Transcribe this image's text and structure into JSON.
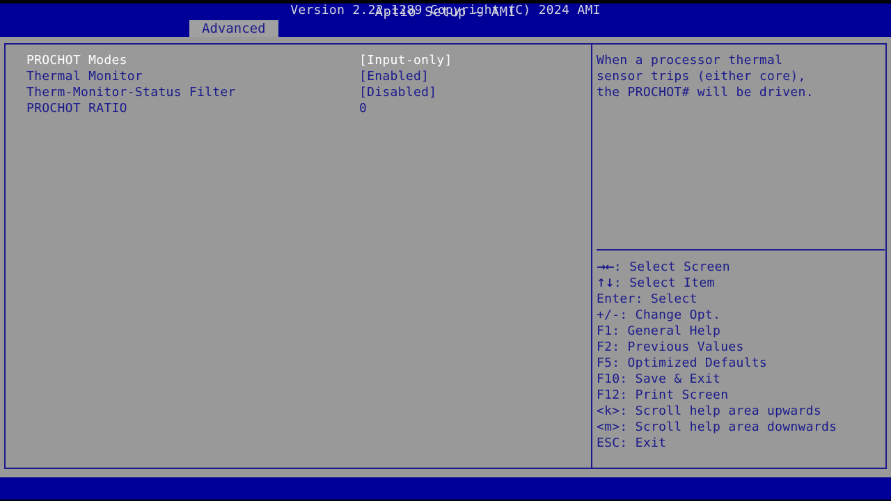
{
  "header": {
    "title": "Aptio Setup – AMI"
  },
  "tabs": [
    {
      "label": "Advanced",
      "active": true
    }
  ],
  "settings": [
    {
      "label": "PROCHOT Modes",
      "value": "[Input-only]",
      "selected": true
    },
    {
      "label": "Thermal Monitor",
      "value": "[Enabled]",
      "selected": false
    },
    {
      "label": "Therm-Monitor-Status Filter",
      "value": "[Disabled]",
      "selected": false
    },
    {
      "label": "PROCHOT RATIO",
      "value": "0",
      "selected": false
    }
  ],
  "help": {
    "text": "When a processor thermal\nsensor trips (either core),\nthe PROCHOT# will be driven."
  },
  "legend": [
    {
      "glyph": "→←",
      "text": ": Select Screen"
    },
    {
      "glyph": "↑↓",
      "text": ": Select Item"
    },
    {
      "glyph": "",
      "text": "Enter: Select"
    },
    {
      "glyph": "",
      "text": "+/-: Change Opt."
    },
    {
      "glyph": "",
      "text": "F1: General Help"
    },
    {
      "glyph": "",
      "text": "F2: Previous Values"
    },
    {
      "glyph": "",
      "text": "F5: Optimized Defaults"
    },
    {
      "glyph": "",
      "text": "F10: Save & Exit"
    },
    {
      "glyph": "",
      "text": "F12: Print Screen"
    },
    {
      "glyph": "",
      "text": "<k>: Scroll help area upwards"
    },
    {
      "glyph": "",
      "text": "<m>: Scroll help area downwards"
    },
    {
      "glyph": "",
      "text": "ESC: Exit"
    }
  ],
  "footer": {
    "text": "Version 2.22.1289 Copyright (C) 2024 AMI"
  },
  "colors": {
    "band_blue": "#000099",
    "border_blue": "#1a1a8c",
    "background_gray": "#999999",
    "tab_gray": "#a0a0a0",
    "text_blue": "#1a1a8c",
    "text_selected": "#ffffff",
    "band_text": "#d4d4dc"
  }
}
